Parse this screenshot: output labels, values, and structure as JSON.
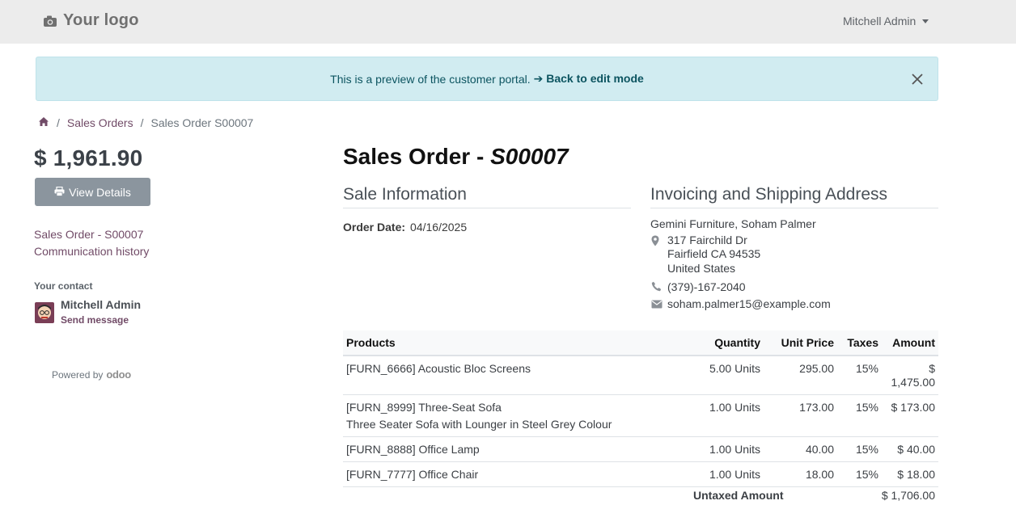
{
  "navbar": {
    "logo_text": "Your logo",
    "logo_icon": "camera-icon",
    "user_name": "Mitchell Admin"
  },
  "alert": {
    "message": "This is a preview of the customer portal.",
    "link_label": "➔ Back to edit mode",
    "close_icon": "close-icon",
    "bg_color": "#d1ecf1",
    "text_color": "#0c5460"
  },
  "breadcrumb": {
    "home_icon": "home-icon",
    "items": [
      "Sales Orders",
      "Sales Order S00007"
    ]
  },
  "sidebar": {
    "amount": "$ 1,961.90",
    "view_details_label": "View Details",
    "links": [
      "Sales Order - S00007",
      "Communication history"
    ],
    "contact_title": "Your contact",
    "contact_name": "Mitchell Admin",
    "send_message_label": "Send message",
    "powered_by": "Powered by",
    "powered_brand": "odoo"
  },
  "main": {
    "title_prefix": "Sales Order - ",
    "title_ref": "S00007",
    "sale_info_heading": "Sale Information",
    "order_date_label": "Order Date:",
    "order_date_value": "04/16/2025",
    "address_heading": "Invoicing and Shipping Address",
    "address": {
      "name": "Gemini Furniture, Soham Palmer",
      "street": "317 Fairchild Dr",
      "city": "Fairfield CA 94535",
      "country": "United States",
      "phone": "(379)-167-2040",
      "email": "soham.palmer15@example.com"
    }
  },
  "table": {
    "headers": [
      "Products",
      "Quantity",
      "Unit Price",
      "Taxes",
      "Amount"
    ],
    "rows": [
      {
        "product": "[FURN_6666] Acoustic Bloc Screens",
        "description": "",
        "quantity": "5.00 Units",
        "unit_price": "295.00",
        "taxes": "15%",
        "amount": "$ 1,475.00"
      },
      {
        "product": "[FURN_8999] Three-Seat Sofa",
        "description": "Three Seater Sofa with Lounger in Steel Grey Colour",
        "quantity": "1.00 Units",
        "unit_price": "173.00",
        "taxes": "15%",
        "amount": "$ 173.00"
      },
      {
        "product": "[FURN_8888] Office Lamp",
        "description": "",
        "quantity": "1.00 Units",
        "unit_price": "40.00",
        "taxes": "15%",
        "amount": "$ 40.00"
      },
      {
        "product": "[FURN_7777] Office Chair",
        "description": "",
        "quantity": "1.00 Units",
        "unit_price": "18.00",
        "taxes": "15%",
        "amount": "$ 18.00"
      }
    ],
    "untaxed_label": "Untaxed Amount",
    "untaxed_value": "$ 1,706.00"
  },
  "colors": {
    "accent": "#714b67",
    "button_bg": "#8b959e",
    "navbar_bg": "#ececec"
  }
}
